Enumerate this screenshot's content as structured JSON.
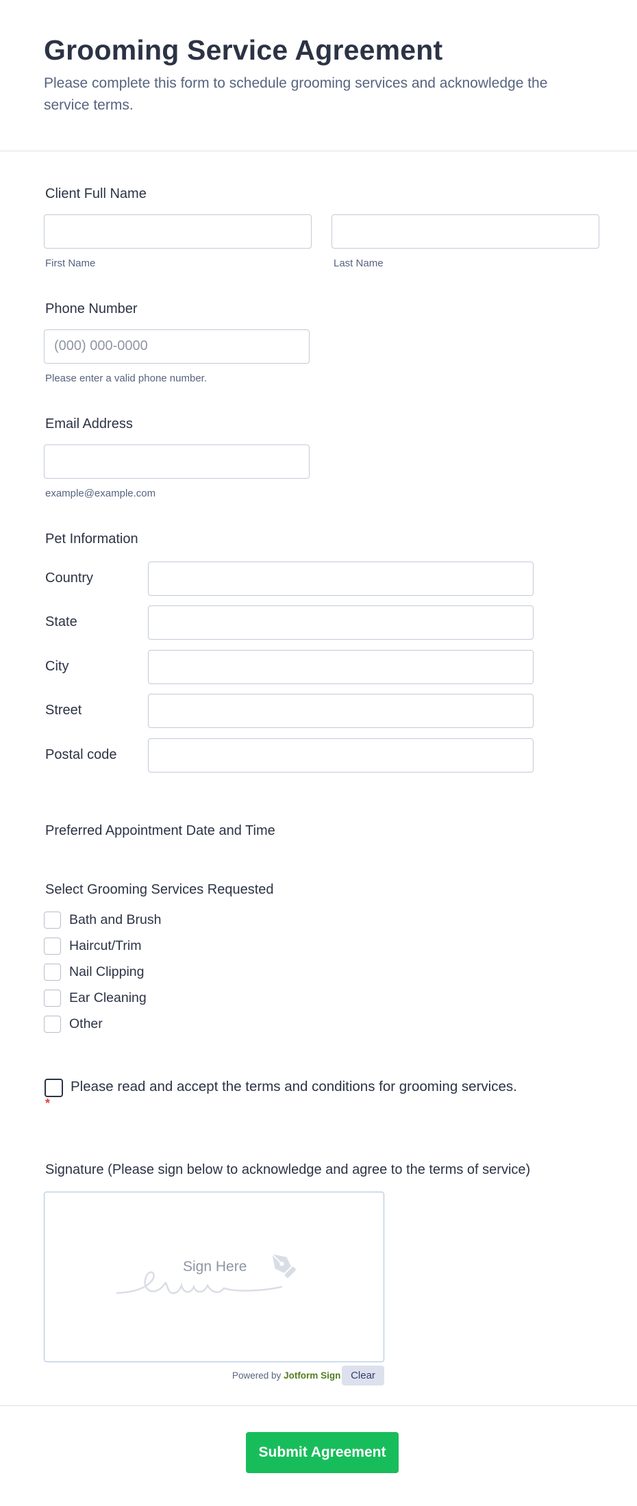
{
  "form": {
    "title": "Grooming Service Agreement",
    "description": "Please complete this form to schedule grooming services and acknowledge the service terms."
  },
  "client_name": {
    "label": "Client Full Name",
    "first_sublabel": "First Name",
    "last_sublabel": "Last Name",
    "first_value": "",
    "last_value": ""
  },
  "phone": {
    "label": "Phone Number",
    "placeholder": "(000) 000-0000",
    "value": "",
    "sublabel": "Please enter a valid phone number."
  },
  "email": {
    "label": "Email Address",
    "value": "",
    "sublabel": "example@example.com"
  },
  "pet_info": {
    "label": "Pet Information",
    "fields": [
      {
        "label": "Country",
        "value": ""
      },
      {
        "label": "State",
        "value": ""
      },
      {
        "label": "City",
        "value": ""
      },
      {
        "label": "Street",
        "value": ""
      },
      {
        "label": "Postal code",
        "value": ""
      }
    ]
  },
  "appointment": {
    "label": "Preferred Appointment Date and Time"
  },
  "services": {
    "label": "Select Grooming Services Requested",
    "options": [
      {
        "label": "Bath and Brush",
        "checked": false
      },
      {
        "label": "Haircut/Trim",
        "checked": false
      },
      {
        "label": "Nail Clipping",
        "checked": false
      },
      {
        "label": "Ear Cleaning",
        "checked": false
      },
      {
        "label": "Other",
        "checked": false
      }
    ]
  },
  "terms": {
    "label": "Please read and accept the terms and conditions for grooming services.",
    "required_mark": "*",
    "checked": false
  },
  "signature": {
    "label": "Signature (Please sign below to acknowledge and agree to the terms of service)",
    "placeholder": "Sign Here",
    "powered_by_prefix": "Powered by",
    "powered_by_brand": "Jotform Sign",
    "clear_label": "Clear",
    "icon": "pen-nib-icon"
  },
  "submit": {
    "label": "Submit Agreement"
  },
  "colors": {
    "submit_button": "#18bd5b",
    "required": "#f23a3c",
    "text": "#2c3345",
    "muted": "#57647e"
  }
}
